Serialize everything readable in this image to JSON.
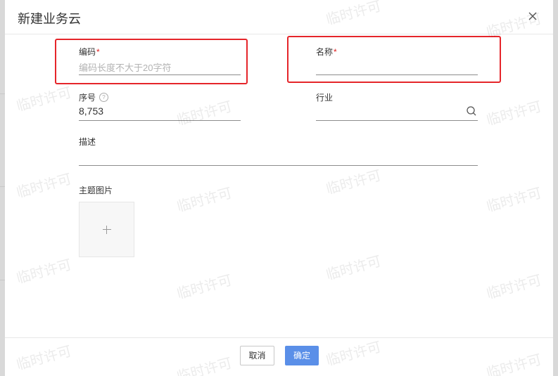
{
  "modal": {
    "title": "新建业务云",
    "close_label": "×"
  },
  "form": {
    "code": {
      "label": "编码",
      "required_mark": "*",
      "placeholder": "编码长度不大于20字符",
      "value": ""
    },
    "name": {
      "label": "名称",
      "required_mark": "*",
      "value": ""
    },
    "seq": {
      "label": "序号",
      "help": "?",
      "value": "8,753"
    },
    "industry": {
      "label": "行业",
      "value": ""
    },
    "description": {
      "label": "描述",
      "value": ""
    },
    "image": {
      "label": "主题图片",
      "add": "+"
    }
  },
  "footer": {
    "cancel_label": "取消",
    "ok_label": "确定"
  },
  "watermark": "临时许可",
  "colors": {
    "primary": "#5a8fe8",
    "highlight": "#e5252a",
    "required": "#e02020"
  }
}
